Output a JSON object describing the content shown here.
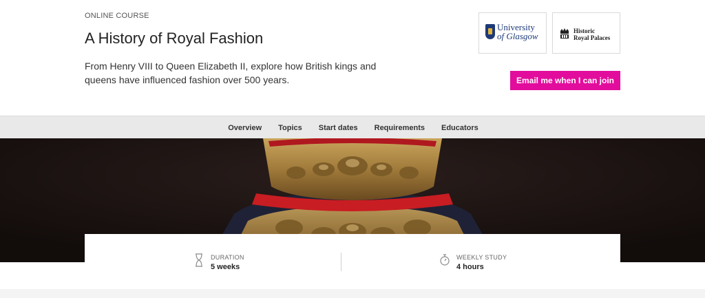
{
  "header": {
    "kicker": "ONLINE COURSE",
    "title": "A History of Royal Fashion",
    "description": "From Henry VIII to Queen Elizabeth II, explore how British kings and queens have influenced fashion over 500 years.",
    "cta_label": "Email me when I can join",
    "cta_color": "#e20d9c"
  },
  "partners": {
    "glasgow_line1": "University",
    "glasgow_line2": "of Glasgow",
    "hrp_line1": "Historic",
    "hrp_line2": "Royal Palaces"
  },
  "nav": {
    "items": [
      "Overview",
      "Topics",
      "Start dates",
      "Requirements",
      "Educators"
    ]
  },
  "hero": {
    "subject": "embroidered royal coat collar"
  },
  "stats": {
    "duration_label": "DURATION",
    "duration_value": "5 weeks",
    "duration_icon": "hourglass-icon",
    "weekly_label": "WEEKLY STUDY",
    "weekly_value": "4 hours",
    "weekly_icon": "stopwatch-icon"
  }
}
